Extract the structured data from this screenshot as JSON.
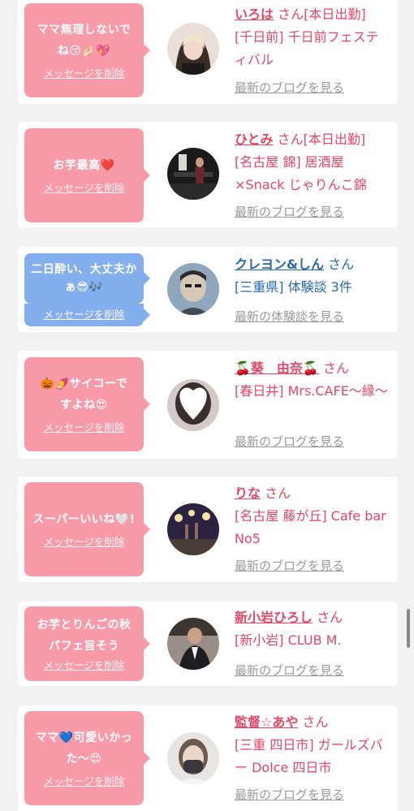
{
  "entries": [
    {
      "message": "ママ無理しないでね😚🤌🏻💖",
      "delete_label": "メッセージを削除",
      "name": "いろは",
      "honorific": "さん",
      "status": "[本日出勤]",
      "shop": "[千日前] 千日前フェスティバル",
      "link": "最新のブログを見る",
      "bubble_color": "#f99aa9"
    },
    {
      "message": "お芋最高❤️",
      "delete_label": "メッセージを削除",
      "name": "ひとみ",
      "honorific": "さん",
      "status": "[本日出勤]",
      "shop": "[名古屋 錦] 居酒屋×Snack じゃりんこ錦",
      "link": "最新のブログを見る",
      "bubble_color": "#f99aa9"
    },
    {
      "message": "二日酔い、大丈夫かぁ😎🎶",
      "delete_label": "メッセージを削除",
      "name": "クレヨン&しん",
      "honorific": "さん",
      "status": "",
      "shop": "[三重県] 体験談 3件",
      "link": "最新の体験談を見る",
      "bubble_color": "#83afee"
    },
    {
      "message": "🎃🍠サイコーですよね😍",
      "delete_label": "メッセージを削除",
      "name": "🍒葵　由奈🍒",
      "honorific": "さん",
      "status": "",
      "shop": "[春日井] Mrs.CAFE〜縁〜",
      "link": "最新のブログを見る",
      "bubble_color": "#f99aa9"
    },
    {
      "message": "スーパーいいね🤍!",
      "delete_label": "メッセージを削除",
      "name": "りな",
      "honorific": "さん",
      "status": "",
      "shop": "[名古屋 藤が丘] Cafe bar No5",
      "link": "最新のブログを見る",
      "bubble_color": "#f99aa9"
    },
    {
      "message": "お芋とりんごの秋パフェ旨そう",
      "delete_label": "メッセージを削除",
      "name": "新小岩ひろし",
      "honorific": "さん",
      "status": "",
      "shop": "[新小岩] CLUB M.",
      "link": "最新のブログを見る",
      "bubble_color": "#f99aa9"
    },
    {
      "message": "ママ💙可愛いかった〜😍",
      "delete_label": "メッセージを削除",
      "name": "監督☆あや",
      "honorific": "さん",
      "status": "",
      "shop": "[三重 四日市] ガールズバー Dolce 四日市",
      "link": "最新のブログを見る",
      "bubble_color": "#f99aa9"
    }
  ]
}
